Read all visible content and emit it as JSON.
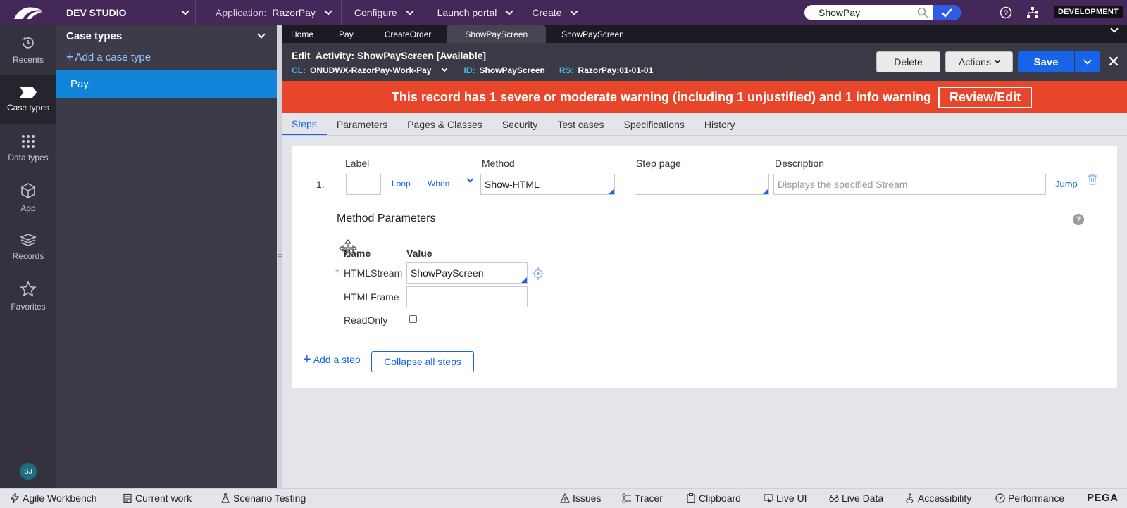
{
  "topbar": {
    "studio": "DEV STUDIO",
    "application_label": "Application:",
    "application_value": "RazorPay",
    "configure": "Configure",
    "launch_portal": "Launch portal",
    "create": "Create",
    "search_value": "ShowPay",
    "environment_badge": "DEVELOPMENT",
    "bg_color": "#44285a"
  },
  "leftnav": {
    "items": [
      {
        "label": "Recents",
        "icon": "history-icon"
      },
      {
        "label": "Case types",
        "icon": "case-types-icon"
      },
      {
        "label": "Data types",
        "icon": "data-types-icon"
      },
      {
        "label": "App",
        "icon": "app-cube-icon"
      },
      {
        "label": "Records",
        "icon": "records-layers-icon"
      },
      {
        "label": "Favorites",
        "icon": "star-icon"
      }
    ],
    "avatar_initials": "SJ"
  },
  "casepanel": {
    "title": "Case types",
    "add_label": "Add a case type",
    "items": [
      "Pay"
    ]
  },
  "doctabs": [
    "Home",
    "Pay",
    "CreateOrder",
    "ShowPayScreen",
    "ShowPayScreen"
  ],
  "edit": {
    "title_prefix": "Edit",
    "title": "Activity: ShowPayScreen [Available]",
    "cl_key": "CL:",
    "cl_value": "ONUDWX-RazorPay-Work-Pay",
    "id_key": "ID:",
    "id_value": "ShowPayScreen",
    "rs_key": "RS:",
    "rs_value": "RazorPay:01-01-01",
    "delete": "Delete",
    "actions": "Actions",
    "save": "Save"
  },
  "warning": {
    "text": "This record has 1 severe or moderate warning (including 1 unjustified) and 1 info warning",
    "button": "Review/Edit",
    "color": "#e8462b"
  },
  "subtabs": [
    "Steps",
    "Parameters",
    "Pages & Classes",
    "Security",
    "Test cases",
    "Specifications",
    "History"
  ],
  "step": {
    "number": "1.",
    "label_header": "Label",
    "method_header": "Method",
    "steppage_header": "Step page",
    "description_header": "Description",
    "loop": "Loop",
    "when": "When",
    "method_value": "Show-HTML",
    "description_placeholder": "Displays the specified Stream",
    "jump": "Jump"
  },
  "method_params": {
    "title": "Method Parameters",
    "name_header": "Name",
    "value_header": "Value",
    "rows": [
      {
        "name": "HTMLStream",
        "value": "ShowPayScreen"
      },
      {
        "name": "HTMLFrame",
        "value": ""
      },
      {
        "name": "ReadOnly",
        "value": ""
      }
    ]
  },
  "actions_row": {
    "add_step": "Add a step",
    "collapse": "Collapse all steps"
  },
  "bottombar": {
    "left": [
      "Agile Workbench",
      "Current work",
      "Scenario Testing"
    ],
    "right": [
      "Issues",
      "Tracer",
      "Clipboard",
      "Live UI",
      "Live Data",
      "Accessibility",
      "Performance"
    ],
    "brand": "PEGA"
  }
}
